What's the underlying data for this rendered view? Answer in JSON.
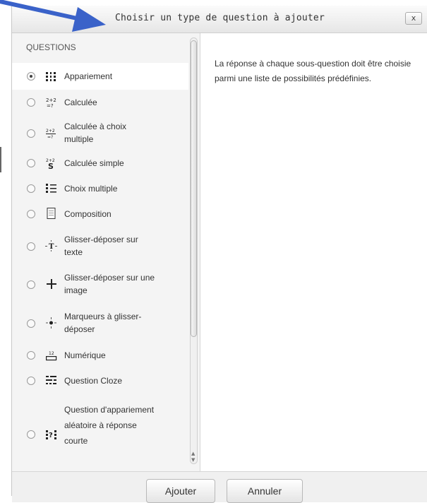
{
  "dialog": {
    "title": "Choisir un type de question à ajouter",
    "close_label": "x"
  },
  "questions": {
    "header": "QUESTIONS",
    "items": [
      {
        "label": "Appariement",
        "selected": true,
        "icon": "matching-icon"
      },
      {
        "label": "Calculée",
        "selected": false,
        "icon": "calculated-icon"
      },
      {
        "label": "Calculée à choix multiple",
        "selected": false,
        "icon": "calculated-multichoice-icon"
      },
      {
        "label": "Calculée simple",
        "selected": false,
        "icon": "calculated-simple-icon"
      },
      {
        "label": "Choix multiple",
        "selected": false,
        "icon": "multichoice-icon"
      },
      {
        "label": "Composition",
        "selected": false,
        "icon": "essay-icon"
      },
      {
        "label": "Glisser-déposer sur texte",
        "selected": false,
        "icon": "drag-drop-text-icon"
      },
      {
        "label": "Glisser-déposer sur une image",
        "selected": false,
        "icon": "drag-drop-image-icon"
      },
      {
        "label": "Marqueurs à glisser-déposer",
        "selected": false,
        "icon": "drag-drop-markers-icon"
      },
      {
        "label": "Numérique",
        "selected": false,
        "icon": "numerical-icon"
      },
      {
        "label": "Question Cloze",
        "selected": false,
        "icon": "cloze-icon"
      },
      {
        "label": "Question d'appariement aléatoire à réponse courte",
        "selected": false,
        "icon": "random-matching-icon"
      }
    ]
  },
  "description": "La réponse à chaque sous-question doit être choisie parmi une liste de possibilités prédéfinies.",
  "footer": {
    "add_label": "Ajouter",
    "cancel_label": "Annuler"
  },
  "colors": {
    "arrow": "#3a62c9"
  }
}
